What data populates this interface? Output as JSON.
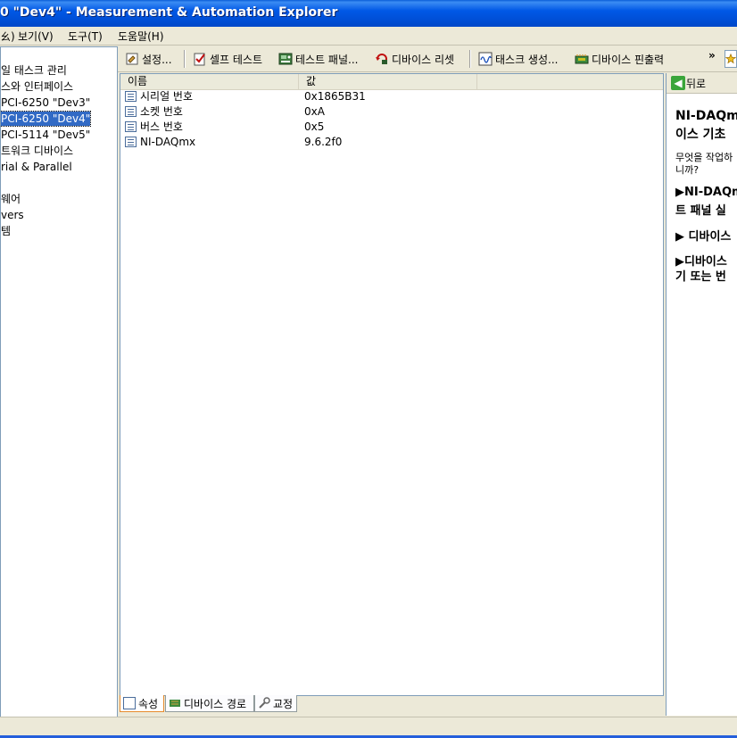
{
  "window": {
    "title": "0 \"Dev4\" - Measurement & Automation Explorer"
  },
  "menu": [
    "ㄠ)",
    "보기(V)",
    "도구(T)",
    "도움말(H)"
  ],
  "tree": {
    "items": [
      "일 태스크 관리",
      "스와 인터페이스",
      "PCI-6250 \"Dev3\"",
      "PCI-6250 \"Dev4\"",
      "PCI-5114 \"Dev5\"",
      "트워크 디바이스",
      "rial & Parallel",
      "웨어",
      "vers",
      "템"
    ],
    "selected_index": 3
  },
  "toolbar": {
    "buttons": [
      {
        "label": "설정...",
        "icon": "settings-icon"
      },
      {
        "label": "셀프 테스트",
        "icon": "self-test-icon"
      },
      {
        "label": "테스트 패널...",
        "icon": "test-panel-icon"
      },
      {
        "label": "디바이스 리셋",
        "icon": "device-reset-icon"
      },
      {
        "label": "태스크 생성...",
        "icon": "create-task-icon"
      },
      {
        "label": "디바이스 핀출력",
        "icon": "device-pinout-icon"
      }
    ],
    "overflow": "»"
  },
  "properties": {
    "columns": [
      "이름",
      "값"
    ],
    "rows": [
      {
        "name": "시리얼 번호",
        "value": "0x1865B31"
      },
      {
        "name": "소켓 번호",
        "value": "0xA"
      },
      {
        "name": "버스 번호",
        "value": "0x5"
      },
      {
        "name": "NI-DAQmx",
        "value": "9.6.2f0"
      }
    ]
  },
  "bottom_tabs": [
    "속성",
    "디바이스 경로",
    "교정"
  ],
  "help": {
    "back_label": "뒤로",
    "heading": [
      "NI-DAQm",
      "이스 기초"
    ],
    "question": [
      "무엇을 작업하",
      "니까?"
    ],
    "links": [
      [
        "▶NI-DAQm",
        "트 패널 실"
      ],
      [
        "▶ 디바이스"
      ],
      [
        "▶디바이스",
        "기 또는 번"
      ]
    ]
  }
}
